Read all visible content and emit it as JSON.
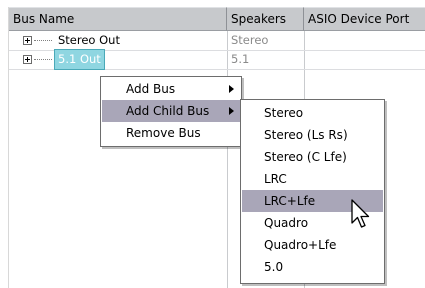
{
  "columns": {
    "bus_name": "Bus Name",
    "speakers": "Speakers",
    "asio_device_port": "ASIO Device Port"
  },
  "rows": [
    {
      "name": "Stereo Out",
      "speakers": "Stereo",
      "selected": false
    },
    {
      "name": "5.1 Out",
      "speakers": "5.1",
      "selected": true
    }
  ],
  "context_menu": {
    "items": [
      {
        "label": "Add Bus",
        "has_submenu": true,
        "highlighted": false
      },
      {
        "label": "Add Child Bus",
        "has_submenu": true,
        "highlighted": true
      },
      {
        "label": "Remove Bus",
        "has_submenu": false,
        "highlighted": false
      }
    ]
  },
  "submenu": {
    "items": [
      {
        "label": "Stereo",
        "highlighted": false
      },
      {
        "label": "Stereo (Ls Rs)",
        "highlighted": false
      },
      {
        "label": "Stereo (C Lfe)",
        "highlighted": false
      },
      {
        "label": "LRC",
        "highlighted": false
      },
      {
        "label": "LRC+Lfe",
        "highlighted": true
      },
      {
        "label": "Quadro",
        "highlighted": false
      },
      {
        "label": "Quadro+Lfe",
        "highlighted": false
      },
      {
        "label": "5.0",
        "highlighted": false
      }
    ]
  },
  "colors": {
    "header_bg": "#c7c9cc",
    "selection_bg": "#8fd6e1",
    "menu_highlight": "#a9a6b8"
  },
  "icons": {
    "expander": "plus-box-icon",
    "cursor": "arrow-pointer-icon",
    "submenu_arrow": "triangle-right-icon"
  }
}
